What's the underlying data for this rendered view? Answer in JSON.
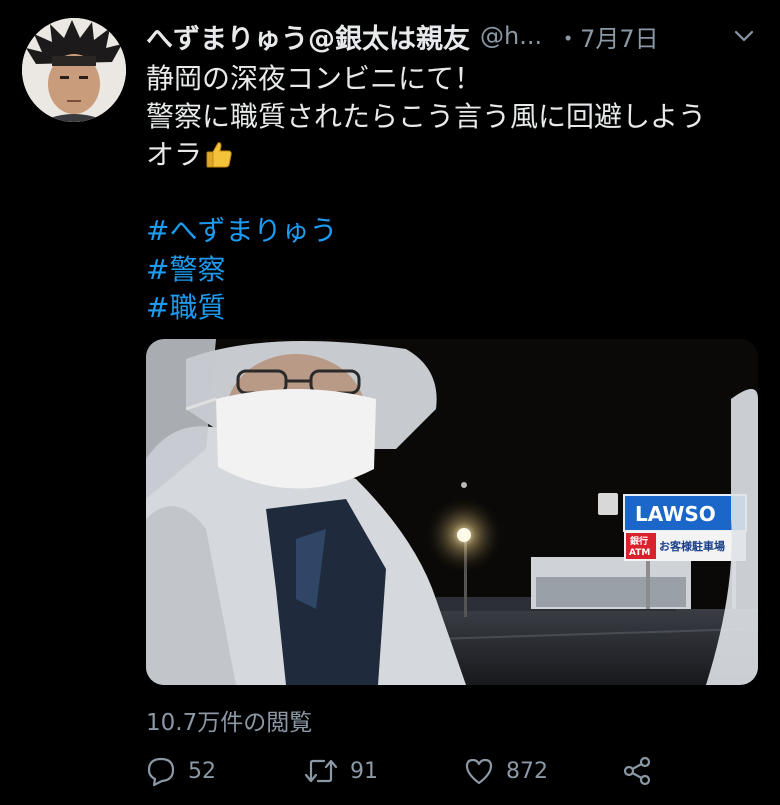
{
  "tweet": {
    "display_name": "へずまりゅう@銀太は親友",
    "handle": "@h...",
    "date": "・7月7日",
    "body_lines": [
      "静岡の深夜コンビニにて！",
      "警察に職質されたらこう言う風に回避しよう",
      "オラ"
    ],
    "emoji": "thumbs-up",
    "hashtags": [
      "#へずまりゅう",
      "#警察",
      "#職質"
    ],
    "media": {
      "store_sign": "LAWSO",
      "sub_sign": "お客様駐車場",
      "atm_line1": "銀行",
      "atm_line2": "ATM"
    },
    "views": "10.7万件の閲覧",
    "actions": {
      "reply_count": "52",
      "retweet_count": "91",
      "like_count": "872"
    }
  },
  "colors": {
    "background": "#000000",
    "text": "#e7e9ea",
    "muted": "#8b98a5",
    "hashtag": "#1d9bf0"
  },
  "icons": [
    "chevron-down-icon",
    "thumbs-up-icon",
    "reply-icon",
    "retweet-icon",
    "like-icon",
    "share-icon"
  ]
}
